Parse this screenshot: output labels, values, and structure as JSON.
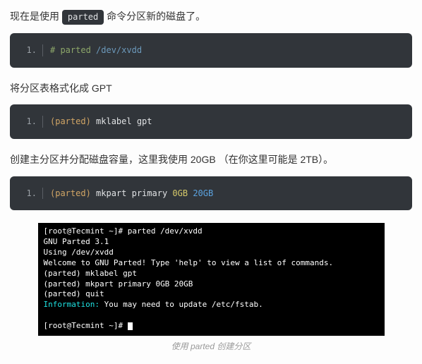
{
  "para1": {
    "t1": "现在是使用 ",
    "code": "parted",
    "t2": " 命令分区新的磁盘了。"
  },
  "code1": {
    "num": "1.",
    "frag": {
      "a": "#",
      "b": " parted ",
      "c": "/dev/xvdd"
    }
  },
  "para2": "将分区表格式化成 GPT",
  "code2": {
    "num": "1.",
    "frag": {
      "a": "(parted)",
      "b": " mklabel gpt"
    }
  },
  "para3": "创建主分区并分配磁盘容量，这里我使用 20GB （在你这里可能是 2TB）。",
  "code3": {
    "num": "1.",
    "frag": {
      "a": "(parted)",
      "b": " mkpart primary ",
      "c": "0GB",
      "d": " ",
      "e": "20GB"
    }
  },
  "terminal": {
    "l1": "[root@Tecmint ~]# parted /dev/xvdd",
    "l2": "GNU Parted 3.1",
    "l3": "Using /dev/xvdd",
    "l4": "Welcome to GNU Parted! Type 'help' to view a list of commands.",
    "l5": "(parted) mklabel gpt",
    "l6": "(parted) mkpart primary 0GB 20GB",
    "l7": "(parted) quit",
    "l8a": "Information: ",
    "l8b": "You may need to update /etc/fstab.",
    "l9": "[root@Tecmint ~]# "
  },
  "caption": "使用 parted 创建分区"
}
